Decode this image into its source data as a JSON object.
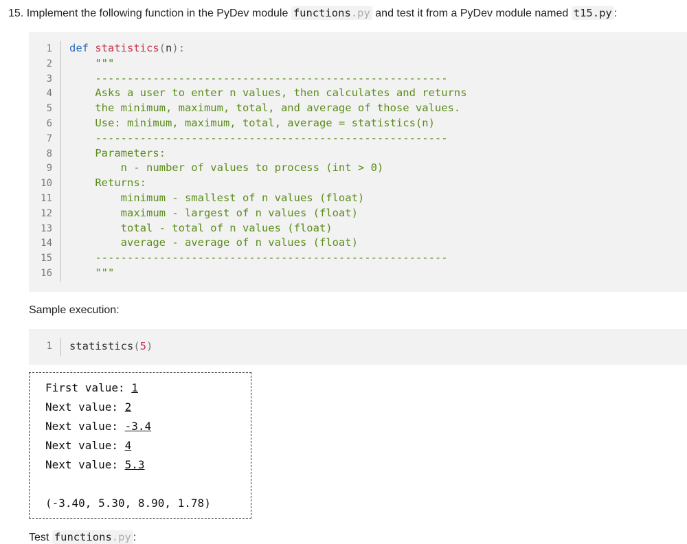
{
  "question": {
    "number": "15.",
    "text_before": "Implement the following function in the PyDev module",
    "module_name": "functions",
    "module_ext": ".py",
    "text_middle": "and test it from a PyDev module named",
    "test_module": "t15.py",
    "text_after": ":"
  },
  "code1": {
    "line_numbers": [
      "1",
      "2",
      "3",
      "4",
      "5",
      "6",
      "7",
      "8",
      "9",
      "10",
      "11",
      "12",
      "13",
      "14",
      "15",
      "16"
    ],
    "def_keyword": "def",
    "func_name": "statistics",
    "paren_open": "(",
    "param": "n",
    "paren_close_colon": "):",
    "doc_lines": [
      "    \"\"\"",
      "    -------------------------------------------------------",
      "    Asks a user to enter n values, then calculates and returns",
      "    the minimum, maximum, total, and average of those values.",
      "    Use: minimum, maximum, total, average = statistics(n)",
      "    -------------------------------------------------------",
      "    Parameters:",
      "        n - number of values to process (int > 0)",
      "    Returns:",
      "        minimum - smallest of n values (float)",
      "        maximum - largest of n values (float)",
      "        total - total of n values (float)",
      "        average - average of n values (float)",
      "    -------------------------------------------------------",
      "    \"\"\""
    ]
  },
  "sample_label": "Sample execution:",
  "code2": {
    "line_number": "1",
    "func_name": "statistics",
    "paren_open": "(",
    "arg": "5",
    "paren_close": ")"
  },
  "console": {
    "inputs": [
      {
        "prompt": "First value: ",
        "value": "1"
      },
      {
        "prompt": "Next value: ",
        "value": "2"
      },
      {
        "prompt": "Next value: ",
        "value": "-3.4"
      },
      {
        "prompt": "Next value: ",
        "value": "4"
      },
      {
        "prompt": "Next value: ",
        "value": "5.3"
      }
    ],
    "result": "(-3.40, 5.30, 8.90, 1.78)"
  },
  "test_label": {
    "text": "Test",
    "module_name": "functions",
    "module_ext": ".py",
    "suffix": ":"
  }
}
